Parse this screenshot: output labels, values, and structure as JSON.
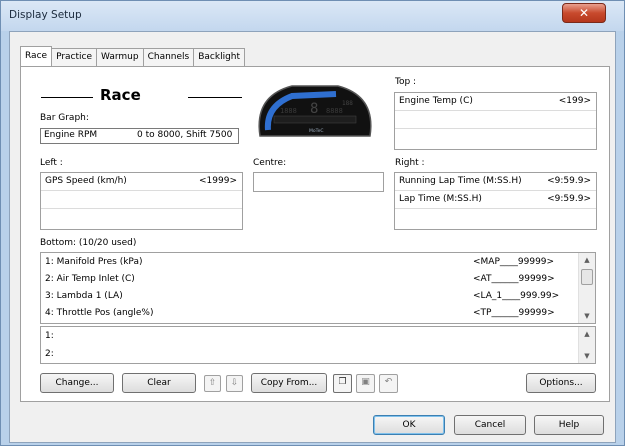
{
  "window": {
    "title": "Display Setup",
    "close_glyph": "✕"
  },
  "tabs": [
    "Race",
    "Practice",
    "Warmup",
    "Channels",
    "Backlight"
  ],
  "heading": "Race",
  "bar_graph": {
    "label": "Bar Graph:",
    "channel": "Engine RPM",
    "range": "0 to 8000, Shift 7500"
  },
  "dash_logo": "MoTeC",
  "top": {
    "label": "Top :",
    "items": [
      {
        "name": "Engine Temp (C)",
        "value": "<199>"
      }
    ]
  },
  "left": {
    "label": "Left :",
    "items": [
      {
        "name": "GPS Speed (km/h)",
        "value": "<1999>"
      }
    ]
  },
  "centre": {
    "label": "Centre:"
  },
  "right": {
    "label": "Right :",
    "items": [
      {
        "name": "Running Lap Time (M:SS.H)",
        "value": "<9:59.9>"
      },
      {
        "name": "Lap Time (M:SS.H)",
        "value": "<9:59.9>"
      }
    ]
  },
  "bottom": {
    "label": "Bottom: (10/20 used)",
    "rows": [
      {
        "name": "1: Manifold Pres (kPa)",
        "code": "<MAP____99999>"
      },
      {
        "name": "2: Air Temp Inlet (C)",
        "code": "<AT______99999>"
      },
      {
        "name": "3: Lambda 1 (LA)",
        "code": "<LA_1____999.99>"
      },
      {
        "name": "4: Throttle Pos (angle%)",
        "code": "<TP______99999>"
      }
    ],
    "empty_rows": [
      "1:",
      "2:"
    ]
  },
  "toolbar": {
    "change": "Change...",
    "clear": "Clear",
    "copy_from": "Copy From...",
    "options": "Options..."
  },
  "footer": {
    "ok": "OK",
    "cancel": "Cancel",
    "help": "Help"
  },
  "colors": {
    "dash_blue": "#2f6fd0",
    "dash_bg": "#111111"
  }
}
